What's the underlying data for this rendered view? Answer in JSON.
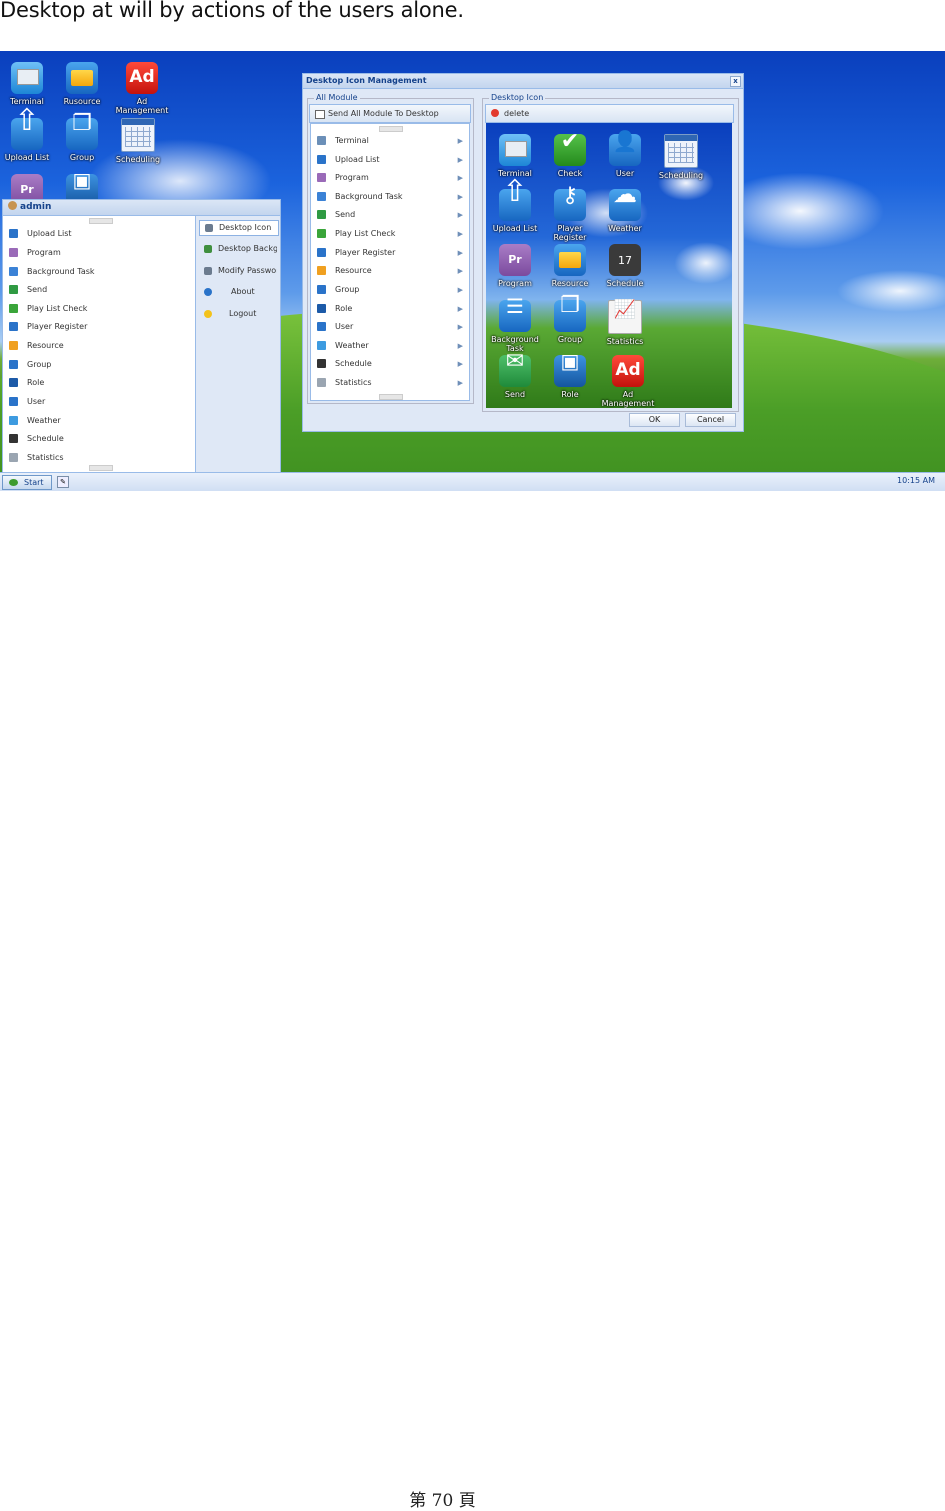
{
  "doc": {
    "intro_text": "Desktop at will by actions of the users alone.",
    "footer": "第 70 頁"
  },
  "desktop": {
    "icons": [
      {
        "label": "Terminal",
        "icon": "terminal-icon"
      },
      {
        "label": "Rusource",
        "icon": "resource-icon"
      },
      {
        "label": "Ad Management",
        "icon": "ad-management-icon"
      },
      {
        "label": "Upload List",
        "icon": "upload-list-icon"
      },
      {
        "label": "Group",
        "icon": "group-icon"
      },
      {
        "label": "Scheduling",
        "icon": "scheduling-icon"
      },
      {
        "label": "",
        "icon": "program-icon",
        "glyph": "Pr"
      },
      {
        "label": "",
        "icon": "role-icon"
      }
    ]
  },
  "start_menu": {
    "user": "admin",
    "items": [
      {
        "label": "Upload List",
        "color": "#2a73c9"
      },
      {
        "label": "Program",
        "color": "#9a6ab8"
      },
      {
        "label": "Background Task",
        "color": "#3b82d6"
      },
      {
        "label": "Send",
        "color": "#2f9a43"
      },
      {
        "label": "Play List Check",
        "color": "#3aa53a"
      },
      {
        "label": "Player Register",
        "color": "#2a73c9"
      },
      {
        "label": "Resource",
        "color": "#f0a020"
      },
      {
        "label": "Group",
        "color": "#2a73c9"
      },
      {
        "label": "Role",
        "color": "#1c5aa8"
      },
      {
        "label": "User",
        "color": "#2a73c9"
      },
      {
        "label": "Weather",
        "color": "#3d9be0"
      },
      {
        "label": "Schedule",
        "color": "#333333"
      },
      {
        "label": "Statistics",
        "color": "#9aa5b1"
      }
    ],
    "tools": [
      {
        "label": "Desktop Icon",
        "color": "#6b7b8f"
      },
      {
        "label": "Desktop Backgn",
        "color": "#3f8f3f"
      },
      {
        "label": "Modify Passwon",
        "color": "#6b7b8f"
      },
      {
        "label": "About",
        "color": "#2a73c9"
      },
      {
        "label": "Logout",
        "color": "#f3c21b"
      }
    ]
  },
  "taskbar": {
    "start_label": "Start",
    "clock": "10:15 AM"
  },
  "window": {
    "title": "Desktop Icon Management",
    "close_glyph": "x",
    "all_module": {
      "legend": "All Module",
      "toolbar_label": "Send All Module To Desktop",
      "items": [
        {
          "label": "Terminal",
          "color": "#6b8fb8"
        },
        {
          "label": "Upload List",
          "color": "#2a73c9"
        },
        {
          "label": "Program",
          "color": "#9a6ab8"
        },
        {
          "label": "Background Task",
          "color": "#3b82d6"
        },
        {
          "label": "Send",
          "color": "#2f9a43"
        },
        {
          "label": "Play List Check",
          "color": "#3aa53a"
        },
        {
          "label": "Player Register",
          "color": "#2a73c9"
        },
        {
          "label": "Resource",
          "color": "#f0a020"
        },
        {
          "label": "Group",
          "color": "#2a73c9"
        },
        {
          "label": "Role",
          "color": "#1c5aa8"
        },
        {
          "label": "User",
          "color": "#2a73c9"
        },
        {
          "label": "Weather",
          "color": "#3d9be0"
        },
        {
          "label": "Schedule",
          "color": "#333333"
        },
        {
          "label": "Statistics",
          "color": "#9aa5b1"
        }
      ]
    },
    "desktop_icon": {
      "legend": "Desktop Icon",
      "toolbar_label": "delete",
      "icons": [
        {
          "label": "Terminal",
          "icon": "terminal-icon"
        },
        {
          "label": "Check",
          "icon": "check-icon"
        },
        {
          "label": "User",
          "icon": "user-icon"
        },
        {
          "label": "Scheduling",
          "icon": "scheduling-icon"
        },
        {
          "label": "Upload List",
          "icon": "upload-list-icon"
        },
        {
          "label": "Player Register",
          "icon": "player-register-icon"
        },
        {
          "label": "Weather",
          "icon": "weather-icon"
        },
        {
          "label": "Program",
          "icon": "program-icon",
          "glyph": "Pr"
        },
        {
          "label": "Resource",
          "icon": "resource-icon"
        },
        {
          "label": "Schedule",
          "icon": "schedule-icon",
          "glyph": "17"
        },
        {
          "label": "Background Task",
          "icon": "background-task-icon"
        },
        {
          "label": "Group",
          "icon": "group-icon"
        },
        {
          "label": "Statistics",
          "icon": "statistics-icon"
        },
        {
          "label": "Send",
          "icon": "send-icon"
        },
        {
          "label": "Role",
          "icon": "role-icon"
        },
        {
          "label": "Ad Management",
          "icon": "ad-management-icon",
          "glyph": "Ad"
        }
      ]
    },
    "ok_label": "OK",
    "cancel_label": "Cancel"
  }
}
